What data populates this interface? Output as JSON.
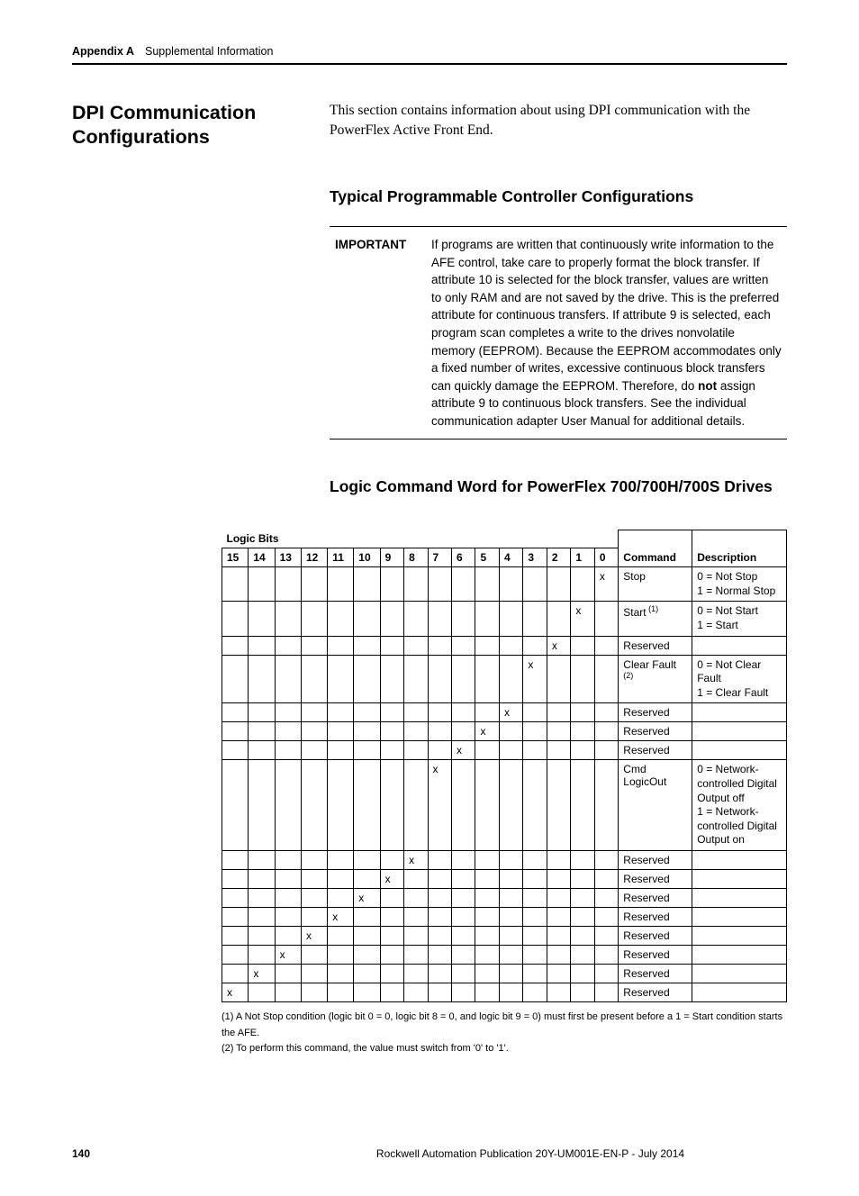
{
  "header": {
    "appendix": "Appendix A",
    "section": "Supplemental Information"
  },
  "side_heading": "DPI Communication Configurations",
  "intro_text": "This section contains information about using DPI communication with the PowerFlex Active Front End.",
  "sub1": "Typical Programmable Controller Configurations",
  "important": {
    "label": "IMPORTANT",
    "text_before": "If programs are written that continuously write information to the AFE control, take care to properly format the block transfer. If attribute 10 is selected for the block transfer, values are written to only RAM and are not saved by the drive. This is the preferred attribute for continuous transfers. If attribute 9 is selected, each program scan completes a write to the drives nonvolatile memory (EEPROM). Because the EEPROM accommodates only a fixed number of writes, excessive continuous block transfers can quickly damage the EEPROM. Therefore, do ",
    "bold": "not",
    "text_after": " assign attribute 9 to continuous block transfers. See the individual communication adapter User Manual for additional details."
  },
  "sub2": "Logic Command Word for PowerFlex 700/700H/700S Drives",
  "logic_bits_label": "Logic Bits",
  "bit_headers": [
    "15",
    "14",
    "13",
    "12",
    "11",
    "10",
    "9",
    "8",
    "7",
    "6",
    "5",
    "4",
    "3",
    "2",
    "1",
    "0"
  ],
  "cmd_header": "Command",
  "desc_header": "Description",
  "rows": [
    {
      "bit": "0",
      "cmd": "Stop",
      "cmd_sup": "",
      "desc": "0 = Not Stop\n1 = Normal Stop"
    },
    {
      "bit": "1",
      "cmd": "Start",
      "cmd_sup": "(1)",
      "desc": "0 = Not Start\n1 = Start"
    },
    {
      "bit": "2",
      "cmd": "Reserved",
      "cmd_sup": "",
      "desc": ""
    },
    {
      "bit": "3",
      "cmd": "Clear Fault",
      "cmd_sup": "(2)",
      "desc": "0 = Not Clear Fault\n1 = Clear Fault"
    },
    {
      "bit": "4",
      "cmd": "Reserved",
      "cmd_sup": "",
      "desc": ""
    },
    {
      "bit": "5",
      "cmd": "Reserved",
      "cmd_sup": "",
      "desc": ""
    },
    {
      "bit": "6",
      "cmd": "Reserved",
      "cmd_sup": "",
      "desc": ""
    },
    {
      "bit": "7",
      "cmd": "Cmd LogicOut",
      "cmd_sup": "",
      "desc": "0 = Network-controlled Digital Output off\n1 = Network-controlled Digital Output on"
    },
    {
      "bit": "8",
      "cmd": "Reserved",
      "cmd_sup": "",
      "desc": ""
    },
    {
      "bit": "9",
      "cmd": "Reserved",
      "cmd_sup": "",
      "desc": ""
    },
    {
      "bit": "10",
      "cmd": "Reserved",
      "cmd_sup": "",
      "desc": ""
    },
    {
      "bit": "11",
      "cmd": "Reserved",
      "cmd_sup": "",
      "desc": ""
    },
    {
      "bit": "12",
      "cmd": "Reserved",
      "cmd_sup": "",
      "desc": ""
    },
    {
      "bit": "13",
      "cmd": "Reserved",
      "cmd_sup": "",
      "desc": ""
    },
    {
      "bit": "14",
      "cmd": "Reserved",
      "cmd_sup": "",
      "desc": ""
    },
    {
      "bit": "15",
      "cmd": "Reserved",
      "cmd_sup": "",
      "desc": ""
    }
  ],
  "footnotes": {
    "n1": "(1)   A Not Stop condition (logic bit 0 = 0, logic bit 8 = 0, and logic bit 9 = 0) must first be present before a 1 = Start condition starts the AFE.",
    "n2": "(2)   To perform this command, the value must switch from '0' to '1'."
  },
  "footer": {
    "page": "140",
    "pub": "Rockwell Automation Publication 20Y-UM001E-EN-P - July 2014"
  }
}
